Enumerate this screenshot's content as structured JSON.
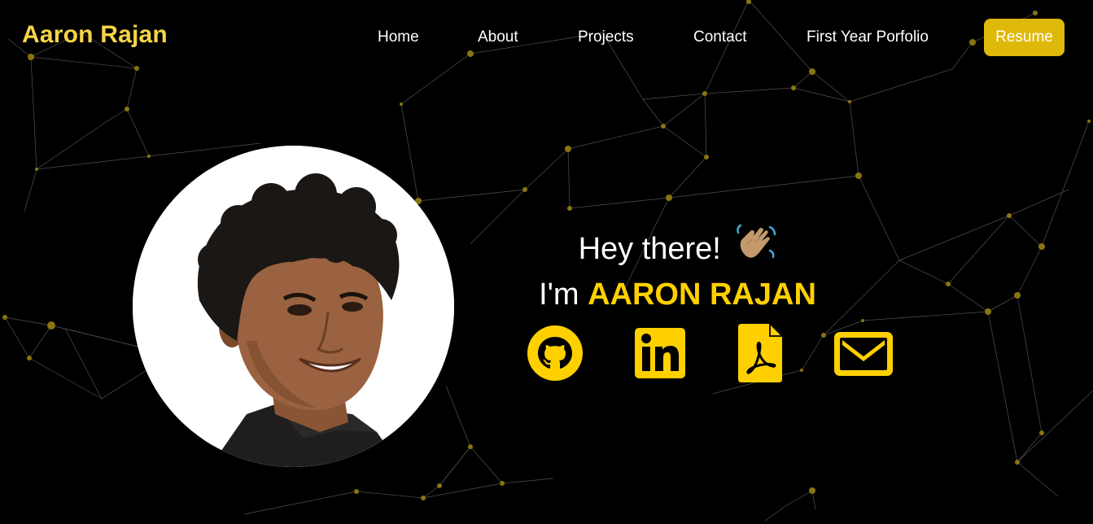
{
  "header": {
    "brand": "Aaron Rajan",
    "nav": {
      "home": "Home",
      "about": "About",
      "projects": "Projects",
      "contact": "Contact",
      "portfolio": "First Year Porfolio"
    },
    "resume_button": "Resume"
  },
  "hero": {
    "greeting": "Hey there!",
    "intro_prefix": "I'm",
    "name": "AARON RAJAN",
    "wave_icon": "waving-hand-emoji"
  },
  "socials": [
    {
      "name": "github",
      "icon": "github-icon"
    },
    {
      "name": "linkedin",
      "icon": "linkedin-icon"
    },
    {
      "name": "resume-pdf",
      "icon": "pdf-icon"
    },
    {
      "name": "email",
      "icon": "mail-icon"
    }
  ],
  "colors": {
    "background": "#000000",
    "accent": "#ffd000",
    "brand": "#f5d547",
    "button": "#dfb90a",
    "text": "#ffffff",
    "network_node": "#8a7410",
    "network_line": "#5a5a5a"
  }
}
